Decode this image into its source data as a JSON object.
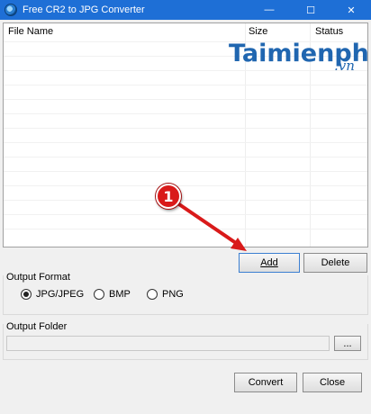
{
  "window": {
    "title": "Free CR2 to JPG Converter",
    "minimize_glyph": "—",
    "maximize_glyph": "☐",
    "close_glyph": "✕"
  },
  "file_list": {
    "columns": [
      "File Name",
      "Size",
      "Status"
    ],
    "rows": []
  },
  "watermark": {
    "brand": "Taimienphi",
    "suffix": ".vn"
  },
  "buttons": {
    "add": "Add",
    "delete": "Delete",
    "browse": "...",
    "convert": "Convert",
    "close": "Close"
  },
  "output_format": {
    "label": "Output Format",
    "options": [
      "JPG/JPEG",
      "BMP",
      "PNG"
    ],
    "selected": "JPG/JPEG"
  },
  "output_folder": {
    "label": "Output Folder",
    "value": ""
  },
  "annotation": {
    "step_number": "1",
    "color": "#d91a1a"
  },
  "colors": {
    "titlebar": "#1e6fd6",
    "watermark": "#2066b0",
    "focus_border": "#3b7fd1"
  },
  "icons": {
    "app": "app-icon",
    "minimize": "minimize-icon",
    "maximize": "maximize-icon",
    "close": "close-icon",
    "arrow": "arrow-icon"
  }
}
